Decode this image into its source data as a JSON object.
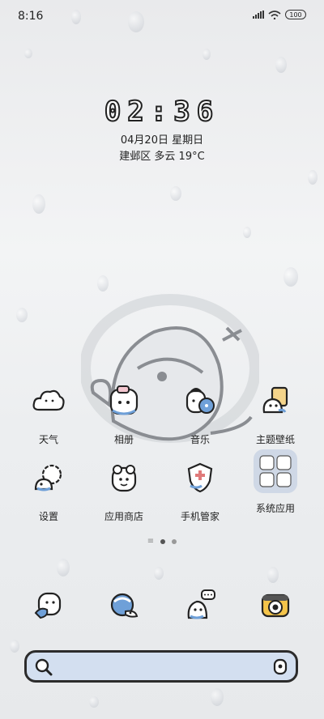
{
  "status_bar": {
    "time": "8:16",
    "battery": "100"
  },
  "lock": {
    "clock": "02:36",
    "date": "04月20日 星期日",
    "weather": "建邺区 多云 19°C"
  },
  "apps_row1": [
    {
      "label": "天气",
      "icon": "weather-cloud-icon"
    },
    {
      "label": "相册",
      "icon": "gallery-icon"
    },
    {
      "label": "音乐",
      "icon": "music-icon"
    },
    {
      "label": "主题壁纸",
      "icon": "theme-icon"
    }
  ],
  "apps_row2": [
    {
      "label": "设置",
      "icon": "settings-icon"
    },
    {
      "label": "应用商店",
      "icon": "app-store-icon"
    },
    {
      "label": "手机管家",
      "icon": "phone-manager-icon"
    },
    {
      "label": "系统应用",
      "icon": "system-apps-folder-icon"
    }
  ],
  "dock": [
    {
      "icon": "phone-icon"
    },
    {
      "icon": "messages-icon"
    },
    {
      "icon": "chat-icon"
    },
    {
      "icon": "camera-icon"
    }
  ],
  "search": {
    "placeholder": ""
  }
}
